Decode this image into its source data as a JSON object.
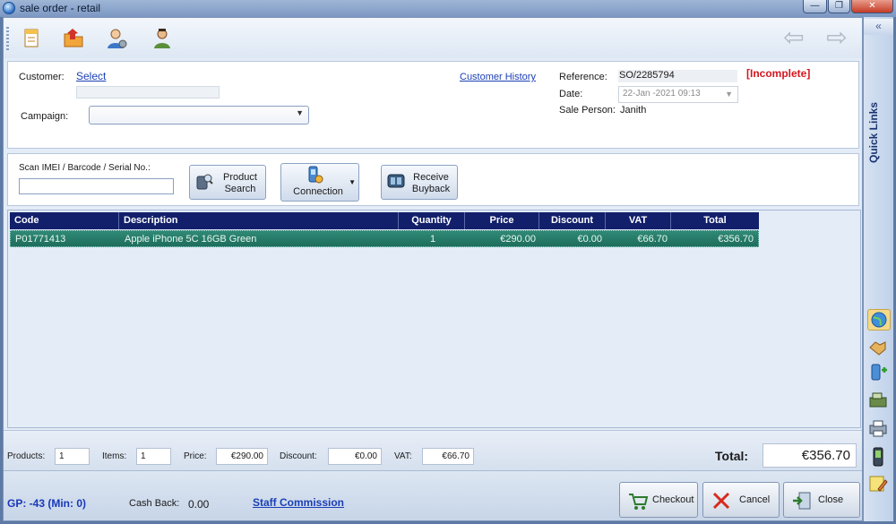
{
  "window": {
    "title": "sale order - retail",
    "min_glyph": "—",
    "max_glyph": "❐",
    "close_glyph": "✕"
  },
  "toolbar": {
    "icons": [
      "new-document-icon",
      "open-folder-icon",
      "customer-icon",
      "user-icon"
    ],
    "nav": {
      "back": "⇦",
      "forward": "⇨"
    }
  },
  "customer": {
    "label": "Customer:",
    "select_link": "Select",
    "campaign_label": "Campaign:",
    "campaign_value": "",
    "history_link": "Customer History"
  },
  "order": {
    "reference_label": "Reference:",
    "reference": "SO/2285794",
    "date_label": "Date:",
    "date": "22-Jan -2021 09:13",
    "salesperson_label": "Sale Person:",
    "salesperson": "Janith",
    "status": "[Incomplete]"
  },
  "scan": {
    "label": "Scan IMEI / Barcode / Serial No.:",
    "value": "",
    "product_search_label": [
      "Product",
      "Search"
    ],
    "connection_label": "Connection",
    "buyback_label": [
      "Receive",
      "Buyback"
    ]
  },
  "table": {
    "headers": [
      "Code",
      "Description",
      "Quantity",
      "Price",
      "Discount",
      "VAT",
      "Total"
    ],
    "rows": [
      {
        "code": "P01771413",
        "description": "Apple iPhone 5C 16GB Green",
        "quantity": "1",
        "price": "€290.00",
        "discount": "€0.00",
        "vat": "€66.70",
        "total": "€356.70"
      }
    ]
  },
  "summary": {
    "products_label": "Products:",
    "products": "1",
    "items_label": "Items:",
    "items": "1",
    "price_label": "Price:",
    "price": "€290.00",
    "discount_label": "Discount:",
    "discount": "€0.00",
    "vat_label": "VAT:",
    "vat": "€66.70",
    "total_label": "Total:",
    "total": "€356.70"
  },
  "bottom": {
    "gp": "GP:  -43 (Min: 0)",
    "cashback_label": "Cash Back:",
    "cashback": "0.00",
    "staff_commission": "Staff Commission",
    "checkout": "Checkout",
    "cancel": "Cancel",
    "close": "Close"
  },
  "sidebar": {
    "collapse": "«",
    "title": "Quick Links",
    "icons": [
      "globe-icon",
      "handshake-icon",
      "add-device-icon",
      "cash-register-icon",
      "printer-icon",
      "mobile-phone-icon",
      "note-pencil-icon"
    ]
  }
}
